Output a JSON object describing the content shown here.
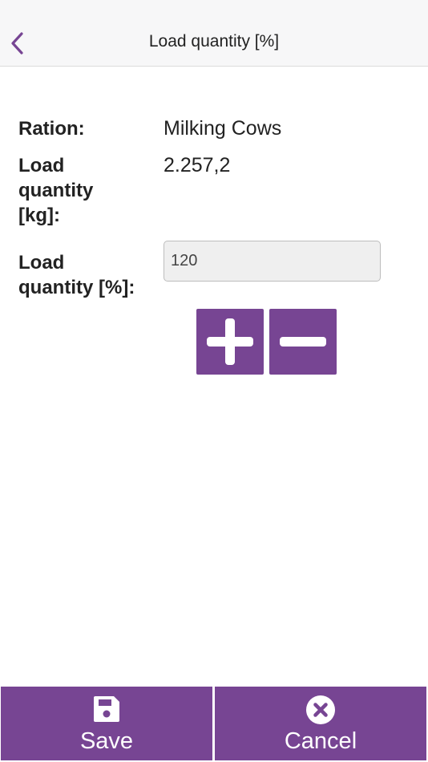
{
  "header": {
    "title": "Load quantity [%]"
  },
  "form": {
    "ration_label": "Ration:",
    "ration_value": "Milking Cows",
    "load_kg_label_line1": "Load",
    "load_kg_label_line2": "quantity",
    "load_kg_label_line3": "[kg]:",
    "load_kg_value": "2.257,2",
    "load_pct_label_line1": "Load",
    "load_pct_label_line2": "quantity [%]:",
    "load_pct_input_value": "120"
  },
  "footer": {
    "save_label": "Save",
    "cancel_label": "Cancel"
  },
  "icons": {
    "back": "chevron-left-icon",
    "plus": "plus-icon",
    "minus": "minus-icon",
    "save": "floppy-disk-icon",
    "cancel": "close-circle-icon"
  },
  "colors": {
    "accent": "#774593",
    "header_bg": "#f7f7f8",
    "input_bg": "#efefef"
  }
}
